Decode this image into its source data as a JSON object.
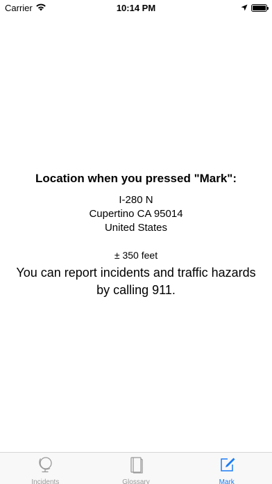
{
  "status_bar": {
    "carrier": "Carrier",
    "time": "10:14 PM"
  },
  "main": {
    "heading": "Location when you pressed \"Mark\":",
    "address_lines": [
      "I-280 N",
      "Cupertino CA 95014",
      "United States"
    ],
    "accuracy": "± 350 feet",
    "report_text": "You can report incidents and traffic hazards by calling 911."
  },
  "tab_bar": {
    "tabs": [
      {
        "label": "Incidents",
        "icon": "globe-icon",
        "active": false
      },
      {
        "label": "Glossary",
        "icon": "book-icon",
        "active": false
      },
      {
        "label": "Mark",
        "icon": "compose-icon",
        "active": true
      }
    ],
    "active_color": "#1a7cf4",
    "inactive_color": "#999999"
  }
}
